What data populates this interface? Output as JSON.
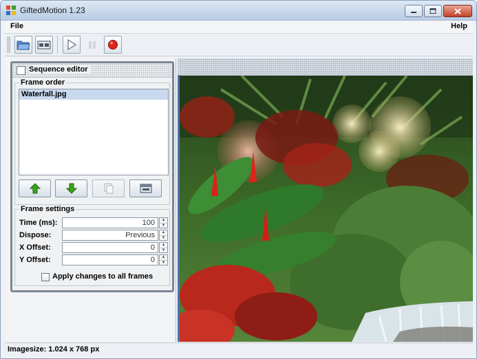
{
  "window": {
    "title": "GiftedMotion 1.23"
  },
  "menu": {
    "file": "File",
    "help": "Help"
  },
  "toolbar": {
    "buttons": [
      "open-folder-icon",
      "frames-icon",
      "play-icon",
      "pause-icon",
      "record-icon"
    ]
  },
  "sequence_editor": {
    "title": "Sequence editor",
    "frame_order": {
      "title": "Frame order",
      "items": [
        "Waterfall.jpg"
      ]
    },
    "action_buttons": [
      "move-up-icon",
      "move-down-icon",
      "copy-icon",
      "delete-icon"
    ],
    "frame_settings": {
      "title": "Frame settings",
      "time_label": "Time (ms):",
      "time_value": "100",
      "dispose_label": "Dispose:",
      "dispose_value": "Previous",
      "xoffset_label": "X Offset:",
      "xoffset_value": "0",
      "yoffset_label": "Y Offset:",
      "yoffset_value": "0"
    },
    "apply_label": "Apply changes to all frames"
  },
  "status": {
    "text": "Imagesize: 1.024 x 768 px"
  },
  "colors": {
    "accent": "#4b74a8",
    "selection": "#c8d9ef",
    "record": "#e0231b",
    "arrow_green": "#3aa31c"
  }
}
